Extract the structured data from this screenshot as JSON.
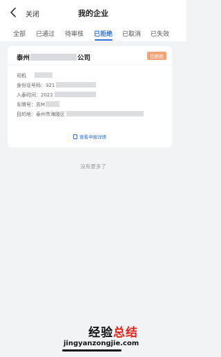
{
  "header": {
    "close_label": "关闭",
    "title": "我的企业"
  },
  "tabs": [
    {
      "label": "全部"
    },
    {
      "label": "已通过"
    },
    {
      "label": "待审核"
    },
    {
      "label": "已拒绝",
      "active": true
    },
    {
      "label": "已取消"
    },
    {
      "label": "已失效"
    }
  ],
  "card": {
    "company_prefix": "泰州",
    "company_suffix": "公司",
    "status_badge": "已拒绝",
    "driver_label": "司机",
    "id_label": "身份证号码：",
    "id_value": "321",
    "entry_label": "入泰时间：",
    "entry_value": "2022",
    "plate_label": "车牌号：",
    "plate_value": "苏M",
    "dest_label": "目的地：",
    "dest_value": "泰州市海陵区",
    "detail_link": "查看申报详情"
  },
  "footer": {
    "no_more": "没有更多了"
  },
  "watermark": {
    "logo_text_a": "经验",
    "logo_text_b": "总结",
    "url": "jingyanzongjie.com"
  },
  "colors": {
    "accent": "#2f6fe0",
    "badge": "#f5a27a",
    "background": "#f2f3f5"
  }
}
